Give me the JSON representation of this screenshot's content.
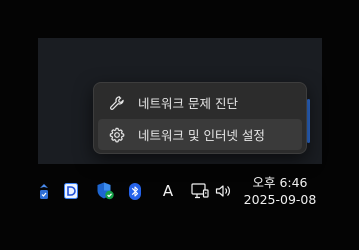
{
  "context_menu": {
    "items": [
      {
        "label": "네트워크 문제 진단",
        "icon": "wrench-icon"
      },
      {
        "label": "네트워크 및 인터넷 설정",
        "icon": "gear-icon"
      }
    ]
  },
  "tray": {
    "icons": [
      "shield-update-icon",
      "app-d-icon",
      "windows-security-icon",
      "bluetooth-icon",
      "input-language-indicator",
      "network-icon",
      "volume-icon"
    ],
    "language_label": "A"
  },
  "clock": {
    "time": "오후 6:46",
    "date": "2025-09-08"
  },
  "colors": {
    "accent": "#2f6fd6",
    "menu_bg": "#2c2c2c",
    "menu_hover": "#3a3a3a",
    "taskbar_bg": "#040404",
    "window_bg": "#1a1d22"
  }
}
